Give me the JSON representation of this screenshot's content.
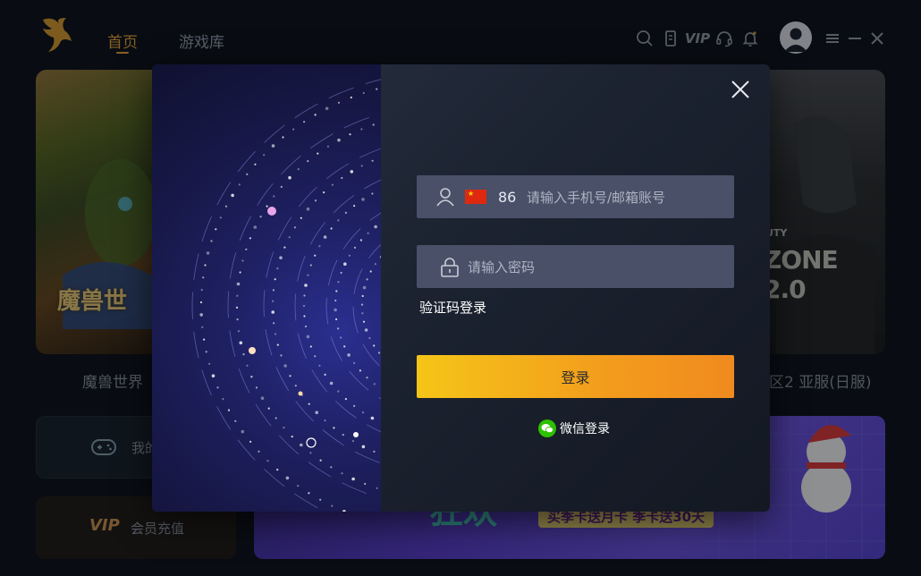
{
  "nav": {
    "tabs": [
      {
        "label": "首页",
        "active": true
      },
      {
        "label": "游戏库",
        "active": false
      }
    ],
    "icons": [
      "search-icon",
      "phone-icon",
      "vip-icon",
      "headset-icon",
      "bell-icon",
      "avatar",
      "menu-icon",
      "minimize-icon",
      "close-icon"
    ],
    "vip_label": "VIP"
  },
  "background": {
    "games": [
      {
        "title": "魔兽世界"
      },
      {
        "title": "区2 亚服(日服)"
      }
    ],
    "wow_logo_text": "魔兽世",
    "cod_logo_text": "ZONE 2.0",
    "cod_small_text": "UTY",
    "side_buttons": [
      {
        "label": "我的"
      },
      {
        "label": "会员充值"
      }
    ],
    "vip_badge": "VIP",
    "banner_text": "买季卡送月卡 季卡送30天"
  },
  "login": {
    "country_code": "86",
    "phone_placeholder": "请输入手机号/邮箱账号",
    "password_placeholder": "请输入密码",
    "sms_login": "验证码登录",
    "submit": "登录",
    "wechat_login": "微信登录"
  },
  "colors": {
    "accent": "#f0a93a",
    "button_start": "#f5c518",
    "button_end": "#f08a1e",
    "wechat_green": "#2dc100"
  }
}
